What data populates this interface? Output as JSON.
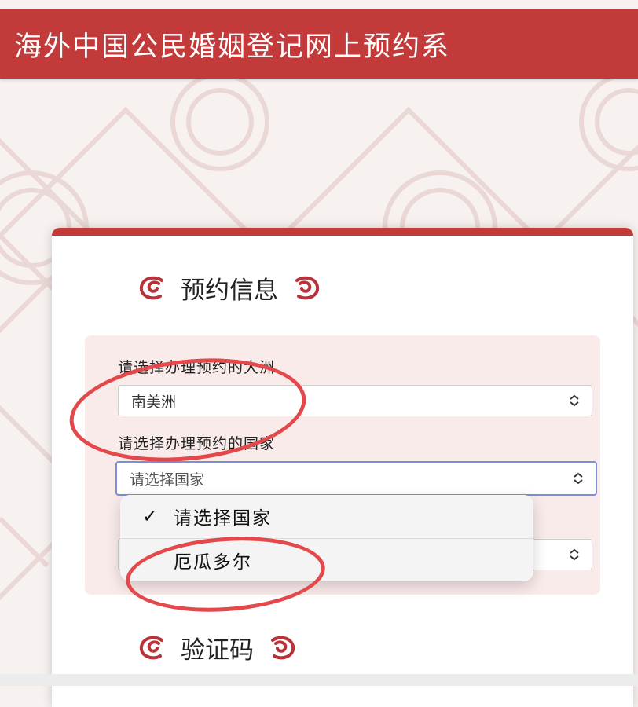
{
  "header": {
    "title": "海外中国公民婚姻登记网上预约系"
  },
  "section_info": {
    "title": "预约信息"
  },
  "continent": {
    "label": "请选择办理预约的大洲",
    "value": "南美洲"
  },
  "country": {
    "label": "请选择办理预约的国家",
    "value": "请选择国家"
  },
  "dropdown": {
    "options": [
      {
        "label": "请选择国家",
        "selected": true
      },
      {
        "label": "厄瓜多尔",
        "selected": false
      }
    ]
  },
  "section_captcha": {
    "title": "验证码"
  },
  "colors": {
    "brand_red": "#c23a3a",
    "focus_blue": "#7a8fd6",
    "annotation_red": "#e3484b"
  }
}
